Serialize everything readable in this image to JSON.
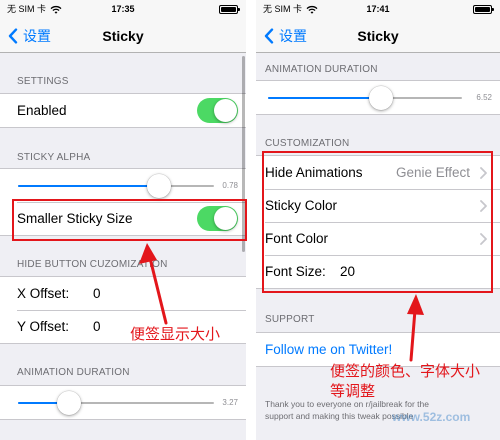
{
  "left": {
    "status": {
      "carrier": "无 SIM 卡",
      "time": "17:35",
      "battery_level": 1
    },
    "nav": {
      "back": "设置",
      "title": "Sticky"
    },
    "settings_header": "SETTINGS",
    "enabled": {
      "label": "Enabled",
      "on": true
    },
    "sticky_alpha_header": "STICKY ALPHA",
    "sticky_alpha": {
      "value": "0.78",
      "level": 0.72
    },
    "smaller_sticky_size": {
      "label": "Smaller Sticky Size",
      "on": true
    },
    "hide_button_header": "HIDE BUTTON CUZOMIZATION",
    "x_offset": {
      "label": "X Offset:",
      "value": "0"
    },
    "y_offset": {
      "label": "Y Offset:",
      "value": "0"
    },
    "animation_header": "ANIMATION DURATION",
    "animation_duration": {
      "value": "3.27",
      "level": 0.26
    }
  },
  "right": {
    "status": {
      "carrier": "无 SIM 卡",
      "time": "17:41",
      "battery_level": 1
    },
    "nav": {
      "back": "设置",
      "title": "Sticky"
    },
    "animation_header": "ANIMATION DURATION",
    "animation_duration": {
      "value": "6.52",
      "level": 0.58
    },
    "customization_header": "CUSTOMIZATION",
    "hide_animations": {
      "label": "Hide Animations",
      "value": "Genie Effect"
    },
    "sticky_color": {
      "label": "Sticky Color"
    },
    "font_color": {
      "label": "Font Color"
    },
    "font_size": {
      "label": "Font Size:",
      "value": "20"
    },
    "support_header": "SUPPORT",
    "twitter_link": "Follow me on Twitter!",
    "footer": [
      "Thank you to everyone on r/jailbreak for the",
      "support and making this tweak possible"
    ]
  },
  "annotations": {
    "left": "便签显示大小",
    "right": [
      "便签的颜色、字体大小",
      "等调整"
    ]
  },
  "watermark": "www.52z.com",
  "icons": {
    "back": "chevron-left-icon",
    "disclosure": "chevron-right-icon",
    "wifi": "wifi-icon",
    "battery": "battery-icon",
    "annotation_pointer": "arrow-up-icon"
  },
  "colors": {
    "accent": "#007aff",
    "toggle_on": "#4cd964",
    "annotation": "#e3161b",
    "background": "#efeff4",
    "section_text": "#6d6d72",
    "detail_text": "#8e8e93"
  }
}
